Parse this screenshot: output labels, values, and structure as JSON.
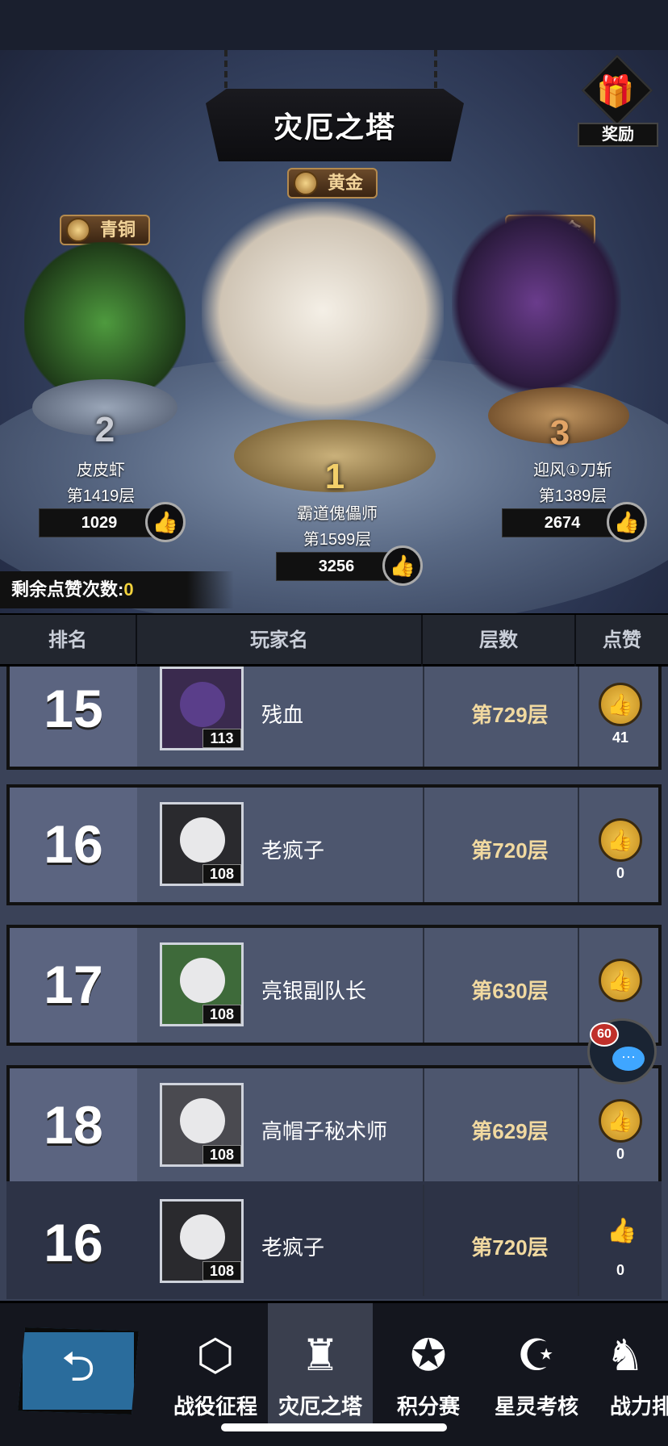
{
  "title": "灾厄之塔",
  "reward_label": "奖励",
  "podium": [
    {
      "place": "1",
      "tier": "黄金",
      "name": "霸道傀儡师",
      "floor": "第1599层",
      "likes": "3256"
    },
    {
      "place": "2",
      "tier": "青铜",
      "name": "皮皮虾",
      "floor": "第1419层",
      "likes": "1029"
    },
    {
      "place": "3",
      "tier": "黄金",
      "name": "迎风①刀斩",
      "floor": "第1389层",
      "likes": "2674"
    }
  ],
  "remaining_likes": {
    "label": "剩余点赞次数:",
    "value": "0"
  },
  "columns": {
    "rank": "排名",
    "player": "玩家名",
    "floor": "层数",
    "like": "点赞"
  },
  "rows": [
    {
      "rank": "15",
      "name": "残血",
      "level": "113",
      "floor": "第729层",
      "likes": "41"
    },
    {
      "rank": "16",
      "name": "老疯子",
      "level": "108",
      "floor": "第720层",
      "likes": "0"
    },
    {
      "rank": "17",
      "name": "亮银副队长",
      "level": "108",
      "floor": "第630层",
      "likes": ""
    },
    {
      "rank": "18",
      "name": "高帽子秘术师",
      "level": "108",
      "floor": "第629层",
      "likes": "0"
    }
  ],
  "self_row": {
    "rank": "16",
    "name": "老疯子",
    "level": "108",
    "floor": "第720层",
    "likes": "0"
  },
  "chat_unread": "60",
  "nav": [
    {
      "label": "战役征程",
      "icon": "campaign-icon"
    },
    {
      "label": "灾厄之塔",
      "icon": "tower-icon"
    },
    {
      "label": "积分赛",
      "icon": "arena-icon"
    },
    {
      "label": "星灵考核",
      "icon": "star-moon-icon"
    },
    {
      "label": "战力排",
      "icon": "power-rank-icon"
    }
  ]
}
